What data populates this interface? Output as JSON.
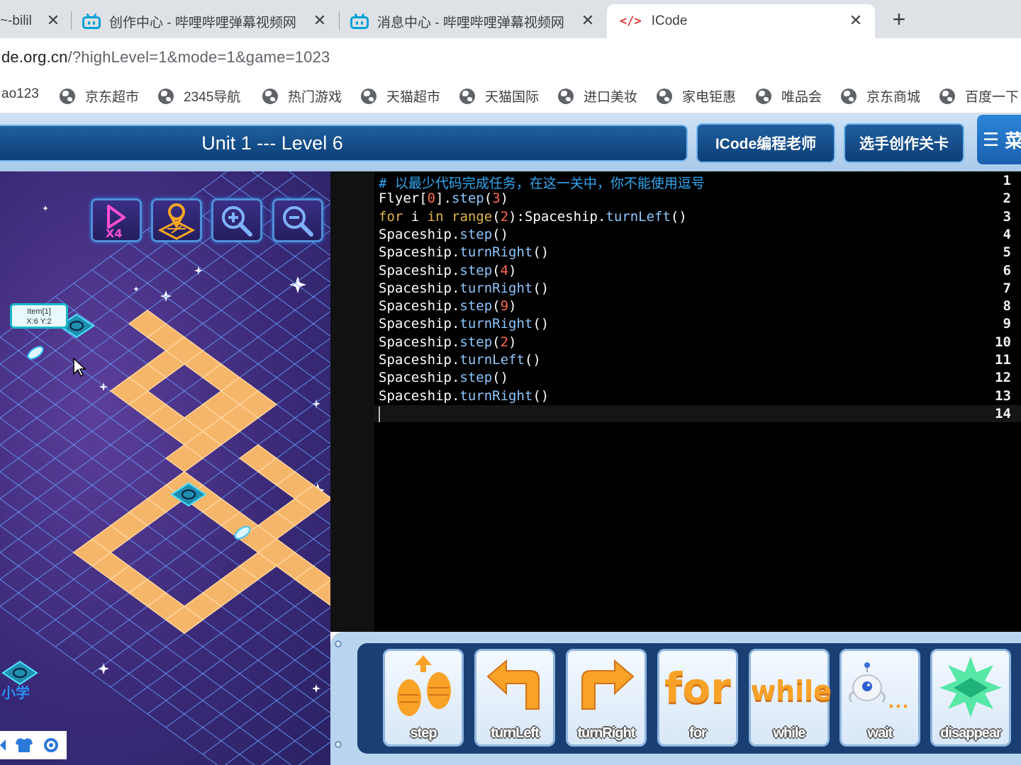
{
  "browser": {
    "tabs": [
      {
        "title": "~-bilil"
      },
      {
        "title": "创作中心 - 哔哩哔哩弹幕视频网"
      },
      {
        "title": "消息中心 - 哔哩哔哩弹幕视频网"
      },
      {
        "title": "ICode",
        "active": true
      }
    ],
    "close_glyph": "✕",
    "new_tab_glyph": "+",
    "url_main": "de.org.cn",
    "url_path": "/?highLevel=1&mode=1&game=1023",
    "bookmarks": [
      "ao123",
      "京东超市",
      "2345导航",
      "热门游戏",
      "天猫超市",
      "天猫国际",
      "进口美妆",
      "家电钜惠",
      "唯品会",
      "京东商城",
      "百度一下"
    ]
  },
  "game": {
    "title": "Unit 1 --- Level 6",
    "teacher_button": "ICode编程老师",
    "create_level_button": "选手创作关卡",
    "menu_glyph": "☰",
    "menu_label": "菜",
    "tooltip_line1": "Item[1]",
    "tooltip_line2": "X:6 Y:2",
    "speed_label": "X4",
    "scene_label": "小学"
  },
  "editor": {
    "line_numbers": [
      "1",
      "2",
      "3",
      "4",
      "5",
      "6",
      "7",
      "8",
      "9",
      "10",
      "11",
      "12",
      "13",
      "14"
    ],
    "lines": [
      "# 以最少代码完成任务，在这一关中，你不能使用逗号",
      "Flyer[0].step(3)",
      "for i in range(2):Spaceship.turnLeft()",
      "Spaceship.step()",
      "Spaceship.turnRight()",
      "Spaceship.step(4)",
      "Spaceship.turnRight()",
      "Spaceship.step(9)",
      "Spaceship.turnRight()",
      "Spaceship.step(2)",
      "Spaceship.turnLeft()",
      "Spaceship.step()",
      "Spaceship.turnRight()",
      ""
    ]
  },
  "toolbox": {
    "blocks": [
      {
        "label": "step"
      },
      {
        "label": "turnLeft"
      },
      {
        "label": "turnRight"
      },
      {
        "label": "for",
        "word": "for"
      },
      {
        "label": "while",
        "word": "while"
      },
      {
        "label": "wait"
      },
      {
        "label": "disappear"
      }
    ]
  },
  "colors": {
    "tile": "#f6b66a",
    "grid": "#6aa0ff",
    "scene_bg": "#3b2a78",
    "editor_bg": "#000000",
    "header_blue": "#0d3f78",
    "block_orange": "#f8a227",
    "comment": "#2ea8f2",
    "keyword": "#e0b54d",
    "number": "#ff6a4d"
  }
}
